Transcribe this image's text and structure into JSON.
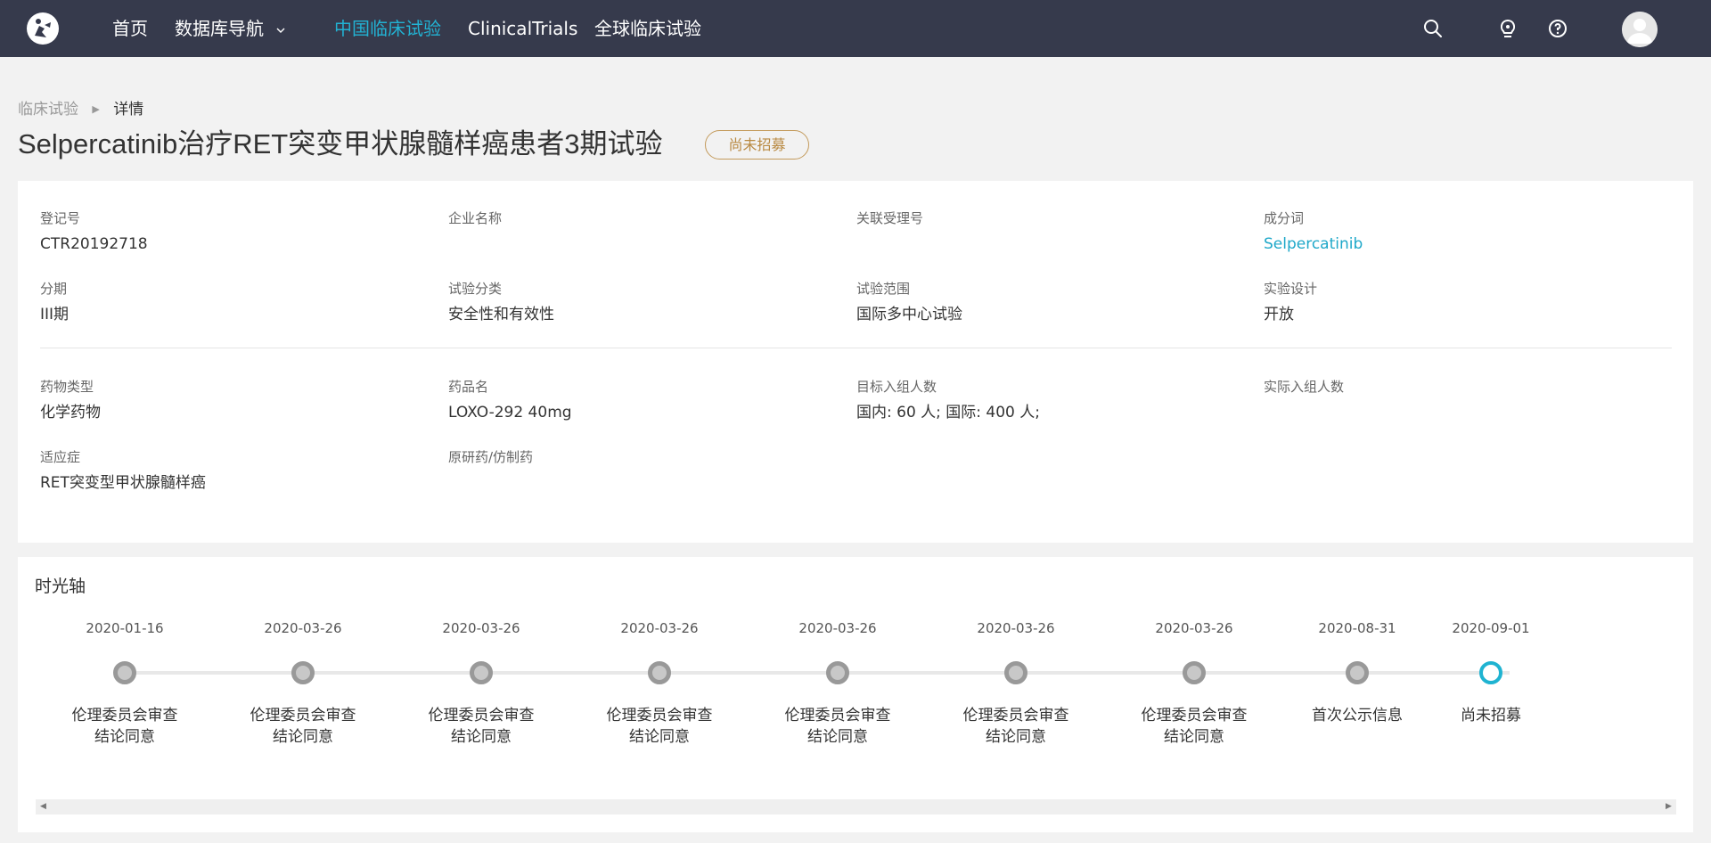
{
  "nav": {
    "items": [
      {
        "label": "首页"
      },
      {
        "label": "数据库导航"
      },
      {
        "label": "中国临床试验"
      },
      {
        "label": "ClinicalTrials"
      },
      {
        "label": "全球临床试验"
      }
    ],
    "active_color": "#22b2d3",
    "bar_color": "#363a4c",
    "icons": [
      "search-icon",
      "lightbulb-icon",
      "help-icon",
      "user-avatar-icon"
    ]
  },
  "breadcrumb": {
    "parent": "临床试验",
    "current": "详情"
  },
  "title": "Selpercatinib治疗RET突变甲状腺髓样癌患者3期试验",
  "status": "尚未招募",
  "info": {
    "reg_no": {
      "label": "登记号",
      "value": "CTR20192718"
    },
    "company": {
      "label": "企业名称",
      "value": ""
    },
    "related_no": {
      "label": "关联受理号",
      "value": ""
    },
    "ingredient": {
      "label": "成分词",
      "value": "Selpercatinib"
    },
    "phase": {
      "label": "分期",
      "value": "III期"
    },
    "category": {
      "label": "试验分类",
      "value": "安全性和有效性"
    },
    "scope": {
      "label": "试验范围",
      "value": "国际多中心试验"
    },
    "design": {
      "label": "实验设计",
      "value": "开放"
    },
    "drug_type": {
      "label": "药物类型",
      "value": "化学药物"
    },
    "drug_name": {
      "label": "药品名",
      "value": "LOXO-292 40mg"
    },
    "target_enroll": {
      "label": "目标入组人数",
      "value": "国内: 60 人;  国际: 400 人;"
    },
    "actual_enroll": {
      "label": "实际入组人数",
      "value": ""
    },
    "indication": {
      "label": "适应症",
      "value": "RET突变型甲状腺髓样癌"
    },
    "origin": {
      "label": "原研药/仿制药",
      "value": ""
    }
  },
  "timeline": {
    "title": "时光轴",
    "events": [
      {
        "date": "2020-01-16",
        "line1": "伦理委员会审查",
        "line2": "结论同意"
      },
      {
        "date": "2020-03-26",
        "line1": "伦理委员会审查",
        "line2": "结论同意"
      },
      {
        "date": "2020-03-26",
        "line1": "伦理委员会审查",
        "line2": "结论同意"
      },
      {
        "date": "2020-03-26",
        "line1": "伦理委员会审查",
        "line2": "结论同意"
      },
      {
        "date": "2020-03-26",
        "line1": "伦理委员会审查",
        "line2": "结论同意"
      },
      {
        "date": "2020-03-26",
        "line1": "伦理委员会审查",
        "line2": "结论同意"
      },
      {
        "date": "2020-03-26",
        "line1": "伦理委员会审查",
        "line2": "结论同意"
      },
      {
        "date": "2020-08-31",
        "line1": "首次公示信息",
        "line2": ""
      },
      {
        "date": "2020-09-01",
        "line1": "尚未招募",
        "line2": ""
      }
    ],
    "current_color": "#1fb3d1"
  }
}
